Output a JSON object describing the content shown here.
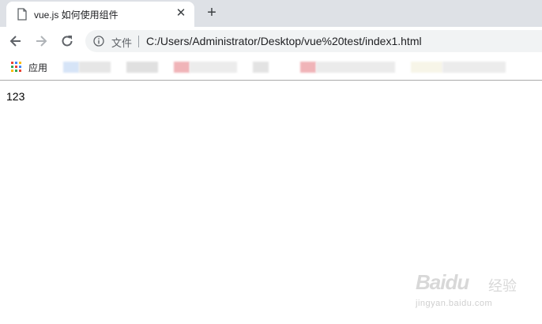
{
  "tab": {
    "title": "vue.js 如何使用组件",
    "close_glyph": "✕"
  },
  "newtab_glyph": "+",
  "address": {
    "site_info_label": "文件",
    "url": "C:/Users/Administrator/Desktop/vue%20test/index1.html"
  },
  "bookmarks": {
    "apps_label": "应用"
  },
  "page": {
    "text": "123"
  },
  "watermark": {
    "logo": "Baidu",
    "cn": "经验",
    "url": "jingyan.baidu.com"
  },
  "colors": {
    "tabstrip": "#dee1e6",
    "omnibox": "#f1f3f4",
    "text": "#202124",
    "icon": "#5f6368"
  }
}
